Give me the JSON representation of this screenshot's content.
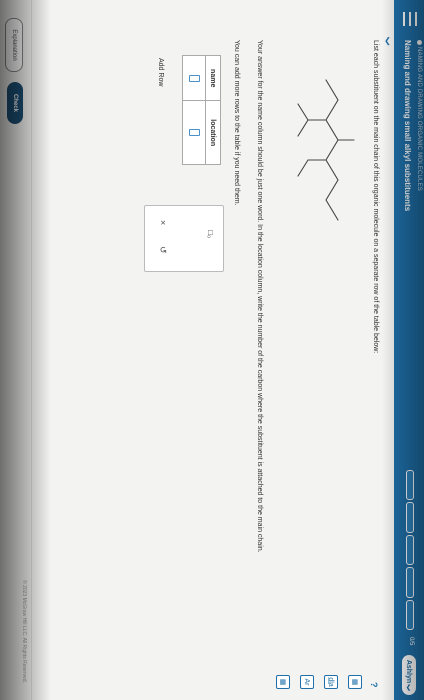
{
  "header": {
    "category": "NAMING AND DRAWING ORGANIC MOLECULES",
    "title": "Naming and drawing small alkyl substituents",
    "progress_count": "0/5",
    "user_name": "Ashlyn",
    "user_chevron": "❯",
    "menu_icon": "hamburger-menu-icon"
  },
  "question": {
    "collapse_glyph": "❯",
    "prompt": "List each substituent on the main chain of this organic molecule on a separate row of the table below:",
    "help_glyph": "?",
    "instruction_1": "Your answer for the name column should be just one word. In the location column, write the number of the carbon where the substituent is attached to the main chain.",
    "instruction_2": "You can add more rows to the table if you need them."
  },
  "table": {
    "headers": [
      "name",
      "location"
    ],
    "rows": [
      {
        "name": "",
        "location": ""
      }
    ]
  },
  "add_row_label": "Add Row",
  "palette": {
    "x_glyph": "×",
    "undo_glyph": "↺",
    "icon_glyph": "□₀"
  },
  "side_tools": [
    "▦",
    "d̲l̲a",
    "Ar",
    "▦"
  ],
  "footer": {
    "explanation_label": "Explanation",
    "check_label": "Check",
    "copyright": "© 2023 McGraw Hill LLC. All Rights Reserved."
  }
}
